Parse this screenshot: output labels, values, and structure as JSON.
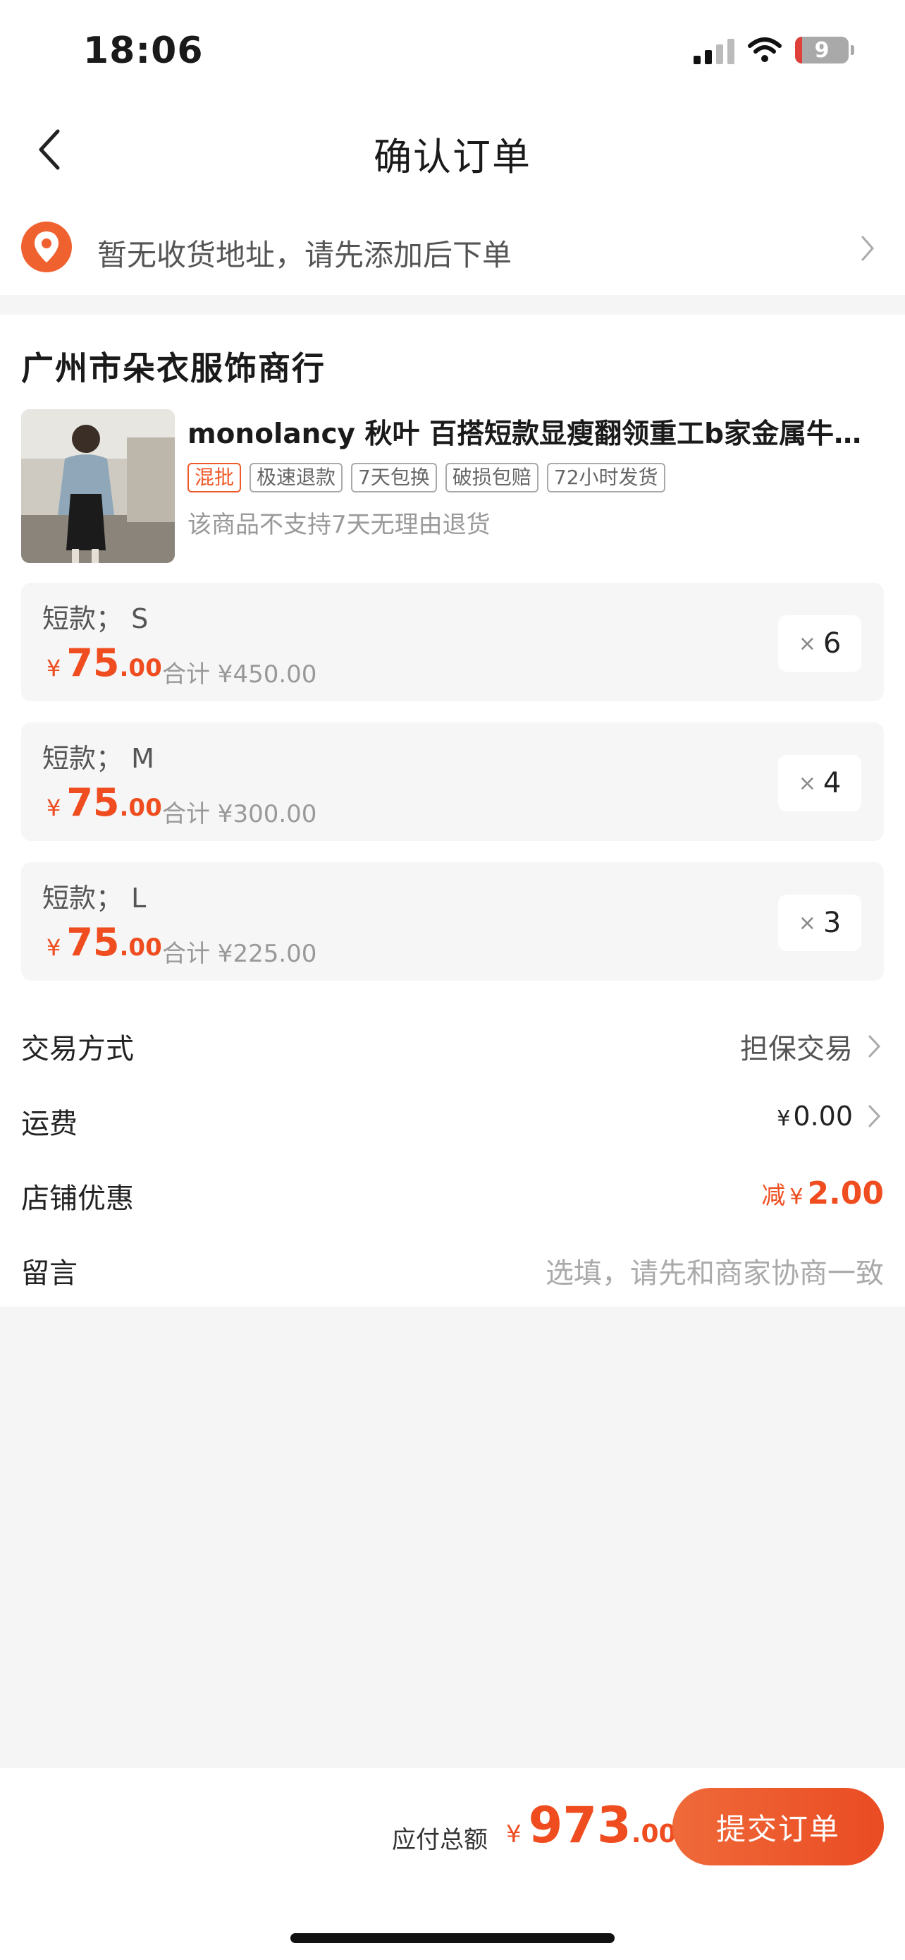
{
  "status_bar": {
    "time": "18:06",
    "battery": "9"
  },
  "nav": {
    "title": "确认订单"
  },
  "address": {
    "text": "暂无收货地址，请先添加后下单"
  },
  "shop": {
    "name": "广州市朵衣服饰商行"
  },
  "product": {
    "title": "monolancy 秋叶 百搭短款显瘦翻领重工b家金属牛仔外套",
    "tags": [
      "混批",
      "极速退款",
      "7天包换",
      "破损包赔",
      "72小时发货"
    ],
    "note": "该商品不支持7天无理由退货"
  },
  "skus": [
    {
      "label": "短款；  S",
      "currency": "¥",
      "price_int": "75",
      "price_dec": ".00",
      "subtotal": "合计 ¥450.00",
      "x": "×",
      "qty": "6"
    },
    {
      "label": "短款；  M",
      "currency": "¥",
      "price_int": "75",
      "price_dec": ".00",
      "subtotal": "合计 ¥300.00",
      "x": "×",
      "qty": "4"
    },
    {
      "label": "短款；  L",
      "currency": "¥",
      "price_int": "75",
      "price_dec": ".00",
      "subtotal": "合计 ¥225.00",
      "x": "×",
      "qty": "3"
    }
  ],
  "rows": {
    "trade_label": "交易方式",
    "trade_value": "担保交易",
    "shipping_label": "运费",
    "shipping_currency": "¥",
    "shipping_value": "0.00",
    "discount_label": "店铺优惠",
    "discount_prefix": "减",
    "discount_currency": "¥",
    "discount_value": "2.00",
    "message_label": "留言",
    "message_placeholder": "选填，请先和商家协商一致"
  },
  "footer": {
    "total_label": "应付总额",
    "currency": "¥",
    "total_int": "973",
    "total_dec": ".00",
    "submit_label": "提交订单"
  },
  "colors": {
    "accent": "#ef4d1f",
    "background": "#f5f5f5"
  }
}
